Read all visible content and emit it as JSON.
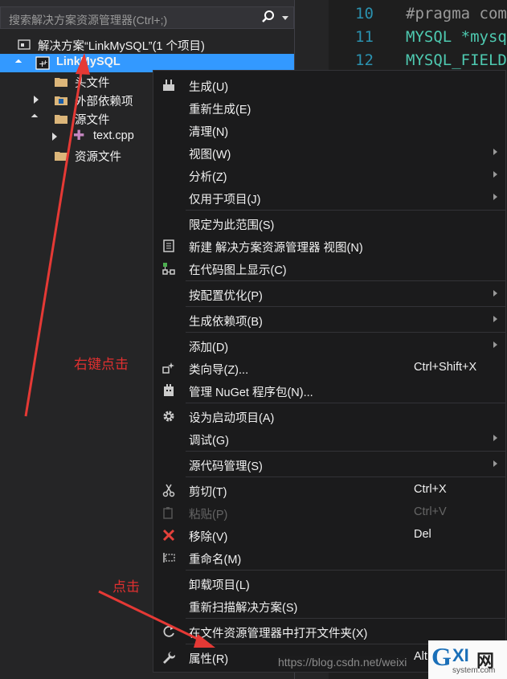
{
  "search": {
    "placeholder": "搜索解决方案资源管理器(Ctrl+;)"
  },
  "tree": {
    "solution": "解决方案“LinkMySQL”(1 个项目)",
    "project": "LinkMySQL",
    "items": [
      {
        "label": "头文件"
      },
      {
        "label": "外部依赖项"
      },
      {
        "label": "源文件"
      },
      {
        "label": "text.cpp"
      },
      {
        "label": "资源文件"
      }
    ]
  },
  "editor": {
    "lines": [
      {
        "num": "10",
        "text": "#pragma com"
      },
      {
        "num": "11",
        "text": "MYSQL *mysq"
      },
      {
        "num": "12",
        "text": "MYSQL_FIELD"
      }
    ]
  },
  "menu": {
    "items": [
      {
        "label": "生成(U)",
        "shortcut": ""
      },
      {
        "label": "重新生成(E)",
        "shortcut": ""
      },
      {
        "label": "清理(N)",
        "shortcut": ""
      },
      {
        "label": "视图(W)",
        "shortcut": ""
      },
      {
        "label": "分析(Z)",
        "shortcut": ""
      },
      {
        "label": "仅用于项目(J)",
        "shortcut": ""
      },
      {
        "label": "限定为此范围(S)",
        "shortcut": ""
      },
      {
        "label": "新建 解决方案资源管理器 视图(N)",
        "shortcut": ""
      },
      {
        "label": "在代码图上显示(C)",
        "shortcut": ""
      },
      {
        "label": "按配置优化(P)",
        "shortcut": ""
      },
      {
        "label": "生成依赖项(B)",
        "shortcut": ""
      },
      {
        "label": "添加(D)",
        "shortcut": ""
      },
      {
        "label": "类向导(Z)...",
        "shortcut": "Ctrl+Shift+X"
      },
      {
        "label": "管理 NuGet 程序包(N)...",
        "shortcut": ""
      },
      {
        "label": "设为启动项目(A)",
        "shortcut": ""
      },
      {
        "label": "调试(G)",
        "shortcut": ""
      },
      {
        "label": "源代码管理(S)",
        "shortcut": ""
      },
      {
        "label": "剪切(T)",
        "shortcut": "Ctrl+X"
      },
      {
        "label": "粘贴(P)",
        "shortcut": "Ctrl+V"
      },
      {
        "label": "移除(V)",
        "shortcut": "Del"
      },
      {
        "label": "重命名(M)",
        "shortcut": ""
      },
      {
        "label": "卸载项目(L)",
        "shortcut": ""
      },
      {
        "label": "重新扫描解决方案(S)",
        "shortcut": ""
      },
      {
        "label": "在文件资源管理器中打开文件夹(X)",
        "shortcut": ""
      },
      {
        "label": "属性(R)",
        "shortcut": "Alt"
      }
    ]
  },
  "annotations": {
    "right_click": "右键点击",
    "click": "点击"
  },
  "watermark": "https://blog.csdn.net/weixi",
  "logo": {
    "g": "G",
    "xi": "XI",
    "net": "网",
    "sys": "system.com"
  },
  "colors": {
    "selection": "#3399ff",
    "annotation": "#e03030",
    "menu_bg": "#1b1b1c",
    "tree_bg": "#252526"
  }
}
